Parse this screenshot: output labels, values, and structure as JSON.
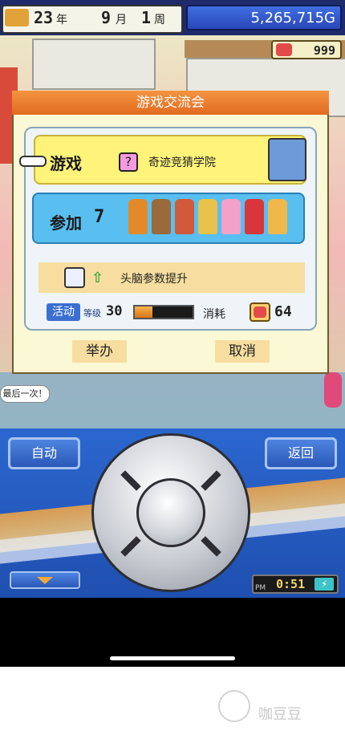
{
  "status_bar": {
    "year": "23",
    "year_unit": "年",
    "month": "9",
    "month_unit": "月",
    "week": "1",
    "week_unit": "周",
    "money": "5,265,715G",
    "hearts": "999"
  },
  "dialog": {
    "title": "游戏交流会",
    "game_label": "游戏",
    "game_name": "奇迹竞猜学院",
    "question_mark": "?",
    "join_label": "参加",
    "join_count": "7",
    "boost_text": "头脑参数提升",
    "activity_label": "活动",
    "level_label": "等级",
    "level_value": "30",
    "level_fill": 0.3,
    "consume_label": "消耗",
    "consume_value": "64",
    "hold_button": "举办",
    "cancel_button": "取消"
  },
  "scene": {
    "banner_text": "最后一次！"
  },
  "controller": {
    "auto_button": "自动",
    "back_button": "返回",
    "clock_period": "PM",
    "clock_time": "0:51"
  },
  "watermark": "咖豆豆",
  "colors": {
    "title_bar": "#e87a2a",
    "game_row": "#fff37a",
    "join_row": "#58bff0",
    "controller": "#2458c0"
  }
}
